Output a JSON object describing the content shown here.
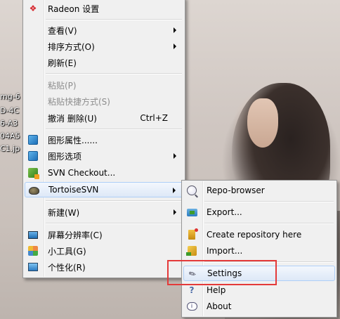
{
  "desktop": {
    "icon_labels": [
      "mg-6",
      "D-4C",
      "6-A3",
      "04A5",
      "C1.jp"
    ]
  },
  "main_menu": {
    "items": [
      {
        "label": "Radeon 设置",
        "icon": "radeon-icon"
      },
      {
        "label": "查看(V)",
        "submenu": true
      },
      {
        "label": "排序方式(O)",
        "submenu": true
      },
      {
        "label": "刷新(E)"
      },
      {
        "label": "粘贴(P)",
        "disabled": true
      },
      {
        "label": "粘贴快捷方式(S)",
        "disabled": true
      },
      {
        "label": "撤消 删除(U)",
        "shortcut": "Ctrl+Z"
      },
      {
        "label": "图形属性......",
        "icon": "graphics-properties-icon"
      },
      {
        "label": "图形选项",
        "icon": "graphics-options-icon",
        "submenu": true
      },
      {
        "label": "SVN Checkout...",
        "icon": "svn-checkout-icon"
      },
      {
        "label": "TortoiseSVN",
        "icon": "tortoisesvn-icon",
        "submenu": true,
        "highlighted": true
      },
      {
        "label": "新建(W)",
        "submenu": true
      },
      {
        "label": "屏幕分辨率(C)",
        "icon": "monitor-icon"
      },
      {
        "label": "小工具(G)",
        "icon": "gadgets-icon"
      },
      {
        "label": "个性化(R)",
        "icon": "personalize-icon"
      }
    ]
  },
  "tortoise_submenu": {
    "items": [
      {
        "label": "Repo-browser",
        "icon": "repo-browser-icon"
      },
      {
        "label": "Export...",
        "icon": "export-icon"
      },
      {
        "label": "Create repository here",
        "icon": "create-repository-icon"
      },
      {
        "label": "Import...",
        "icon": "import-icon"
      },
      {
        "label": "Settings",
        "icon": "settings-icon",
        "highlighted": true
      },
      {
        "label": "Help",
        "icon": "help-icon"
      },
      {
        "label": "About",
        "icon": "about-icon"
      }
    ]
  },
  "colors": {
    "highlight_border": "#aecff7",
    "annotation_red": "#e43a3a"
  }
}
